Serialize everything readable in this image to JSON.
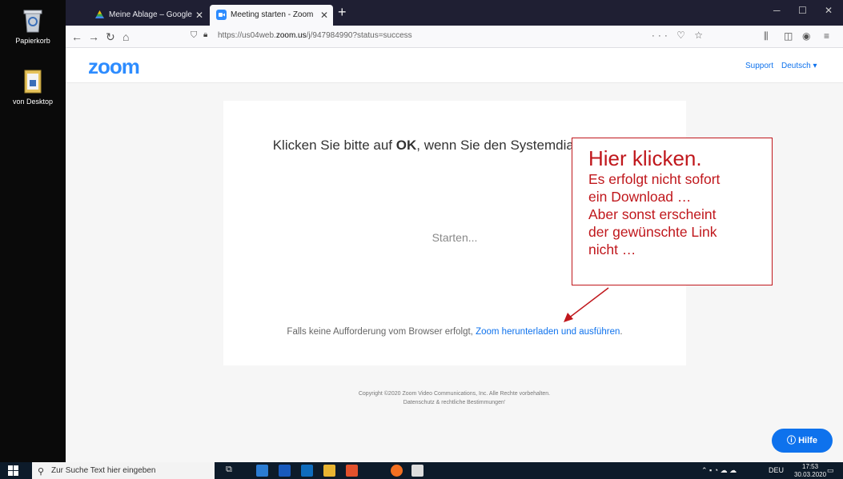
{
  "desktop": {
    "recycle_bin_label": "Papierkorb",
    "folder_label": "von Desktop"
  },
  "browser": {
    "tabs": [
      {
        "label": "Meine Ablage – Google Drive",
        "close": "✕"
      },
      {
        "label": "Meeting starten - Zoom",
        "close": "✕"
      }
    ],
    "new_tab": "+",
    "url_prefix": "https://us04web.",
    "url_domain": "zoom.us",
    "url_path": "/j/947984990?status=success",
    "url_actions": "··· ♡ ☆"
  },
  "zoom": {
    "logo": "zoom",
    "support_link": "Support",
    "language_link": "Deutsch ▾",
    "title_before": "Klicken Sie bitte auf ",
    "title_bold": "OK",
    "title_after": ", wenn Sie den Systemdialog sehen.",
    "status": "Starten...",
    "footer_text": "Falls keine Aufforderung vom Browser erfolgt, ",
    "footer_link": "Zoom herunterladen und ausführen",
    "footer_end": ".",
    "copyright": "Copyright ©2020 Zoom Video Communications, Inc. Alle Rechte vorbehalten.",
    "privacy": "Datenschutz & rechtliche Bestimmungen'",
    "help_button": "Hilfe"
  },
  "annotation": {
    "title": "Hier klicken.",
    "lines": [
      "Es erfolgt nicht sofort",
      "ein Download …",
      "Aber sonst erscheint",
      "der gewünschte Link",
      "nicht …"
    ],
    "color": "#c0171c"
  },
  "taskbar": {
    "search_placeholder": "Zur Suche Text hier eingeben",
    "language": "DEU",
    "time": "17:53",
    "date": "30.03.2020"
  }
}
